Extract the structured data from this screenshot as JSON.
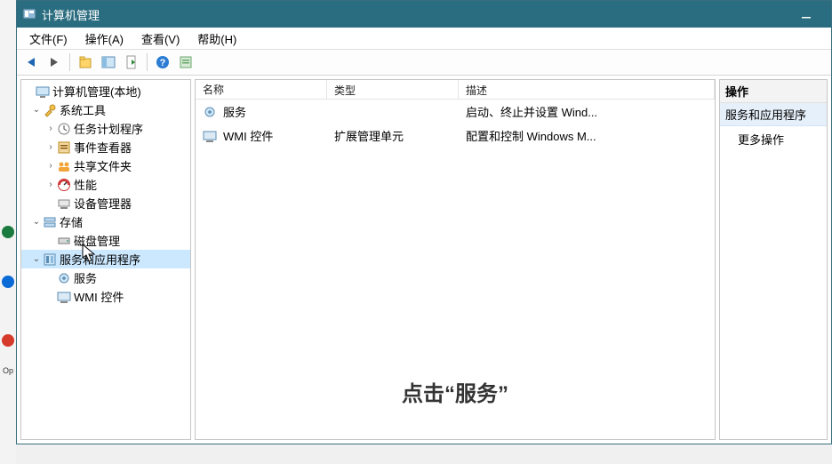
{
  "window": {
    "title": "计算机管理"
  },
  "menu": {
    "file": "文件(F)",
    "action": "操作(A)",
    "view": "查看(V)",
    "help": "帮助(H)"
  },
  "tree": {
    "root": "计算机管理(本地)",
    "systemTools": "系统工具",
    "taskScheduler": "任务计划程序",
    "eventViewer": "事件查看器",
    "sharedFolders": "共享文件夹",
    "performance": "性能",
    "deviceManager": "设备管理器",
    "storage": "存储",
    "diskManagement": "磁盘管理",
    "servicesApps": "服务和应用程序",
    "services": "服务",
    "wmi": "WMI 控件"
  },
  "list": {
    "columns": {
      "name": "名称",
      "type": "类型",
      "desc": "描述"
    },
    "rows": [
      {
        "name": "服务",
        "type": "",
        "desc": "启动、终止并设置 Wind..."
      },
      {
        "name": "WMI 控件",
        "type": "扩展管理单元",
        "desc": "配置和控制 Windows M..."
      }
    ]
  },
  "actions": {
    "header": "操作",
    "section": "服务和应用程序",
    "more": "更多操作"
  },
  "caption": "点击“服务”"
}
